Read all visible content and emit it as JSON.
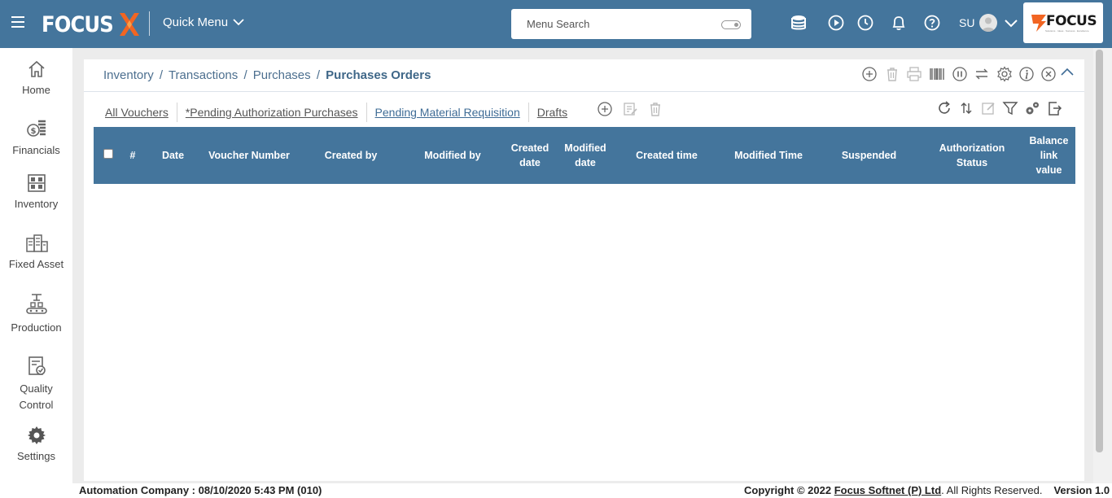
{
  "topbar": {
    "logo_text": "FOCUS",
    "quick_menu_label": "Quick Menu",
    "search_placeholder": "Menu Search",
    "user_initials": "SU",
    "brand_text": "FOCUS",
    "brand_tagline": "Solutions · Ideas · Success · Excellence",
    "accent_color": "#44759c",
    "brand_orange": "#f26522"
  },
  "sidebar": {
    "items": [
      {
        "label": "Home",
        "icon": "home-icon"
      },
      {
        "label": "Financials",
        "icon": "coins-icon"
      },
      {
        "label": "Inventory",
        "icon": "warehouse-icon"
      },
      {
        "label": "Fixed Asset",
        "icon": "building-icon"
      },
      {
        "label": "Production",
        "icon": "conveyor-icon"
      },
      {
        "label": "Quality",
        "label2": "Control",
        "icon": "checklist-icon"
      },
      {
        "label": "Settings",
        "icon": "gear-icon"
      }
    ]
  },
  "breadcrumb": {
    "part1": "Inventory",
    "part2": "Transactions",
    "part3": "Purchases",
    "current": "Purchases Orders",
    "sep": "/"
  },
  "tabs": [
    {
      "label": "All Vouchers"
    },
    {
      "label": "*Pending Authorization Purchases"
    },
    {
      "label": "Pending Material Requisition"
    },
    {
      "label": "Drafts"
    }
  ],
  "grid": {
    "columns": [
      {
        "label": "#"
      },
      {
        "label": "Date"
      },
      {
        "label": "Voucher Number"
      },
      {
        "label": "Created by"
      },
      {
        "label": "Modified by"
      },
      {
        "label": "Created date"
      },
      {
        "label": "Modified date"
      },
      {
        "label": "Created time"
      },
      {
        "label": "Modified Time"
      },
      {
        "label": "Suspended"
      },
      {
        "label": "Authorization Status"
      },
      {
        "label": "Balance link value"
      }
    ],
    "rows": []
  },
  "footer": {
    "left": "Automation Company : 08/10/2020 5:43 PM (010)",
    "copyright_prefix": "Copyright © 2022 ",
    "company_link": "Focus Softnet (P) Ltd",
    "copyright_suffix": ". All Rights Reserved.",
    "version": "Version 1.0"
  }
}
